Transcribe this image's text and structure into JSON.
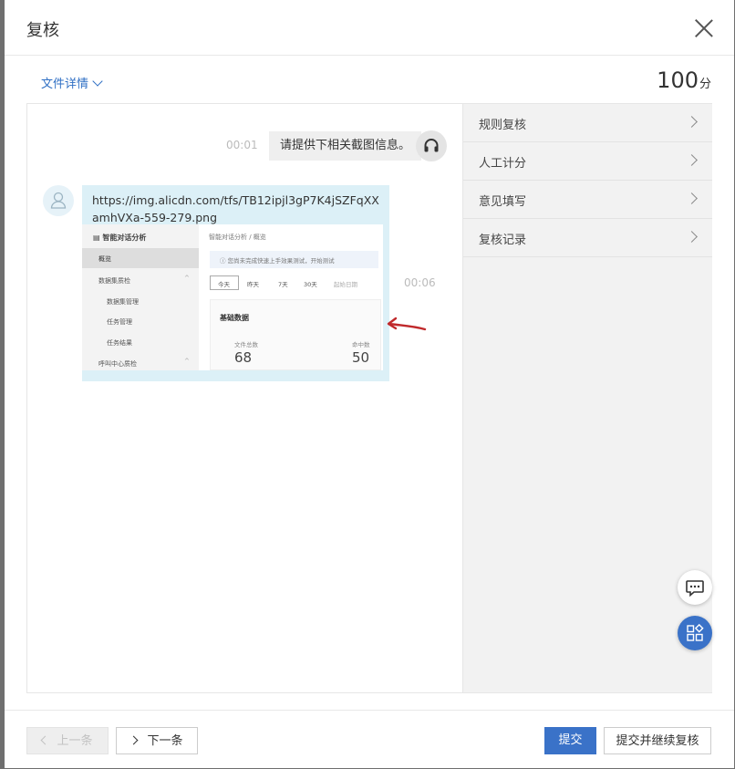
{
  "dialog": {
    "title": "复核"
  },
  "file_detail": {
    "label": "文件详情"
  },
  "score": {
    "value": "100",
    "unit": "分"
  },
  "chat": {
    "agent_message": {
      "time": "00:01",
      "text": "请提供下相关截图信息。"
    },
    "user_message": {
      "time": "00:06",
      "url": "https://img.alicdn.com/tfs/TB12ipjl3gP7K4jSZFqXXamhVXa-559-279.png",
      "image": {
        "sidebar_title": "智能对话分析",
        "menu": [
          "概览",
          "数据集质检",
          "数据集管理",
          "任务管理",
          "任务结果",
          "呼叫中心质检"
        ],
        "breadcrumb": "智能对话分析 / 概览",
        "notice": "您尚未完成快速上手效果测试，开始测试",
        "date_tabs": [
          "今天",
          "昨天",
          "7天",
          "30天",
          "起始日期"
        ],
        "card_title": "基础数据",
        "stats": [
          {
            "label": "文件总数",
            "value": "68"
          },
          {
            "label": "命中数",
            "value": "50"
          }
        ]
      }
    }
  },
  "side_menu": [
    {
      "label": "规则复核"
    },
    {
      "label": "人工计分"
    },
    {
      "label": "意见填写"
    },
    {
      "label": "复核记录"
    }
  ],
  "footer": {
    "prev_label": "上一条",
    "next_label": "下一条",
    "submit_label": "提交",
    "submit_continue_label": "提交并继续复核"
  },
  "colors": {
    "primary": "#3a72c8",
    "link": "#2f6fc4",
    "bubble_user": "#dcf0f7",
    "bubble_agent": "#efefef"
  }
}
